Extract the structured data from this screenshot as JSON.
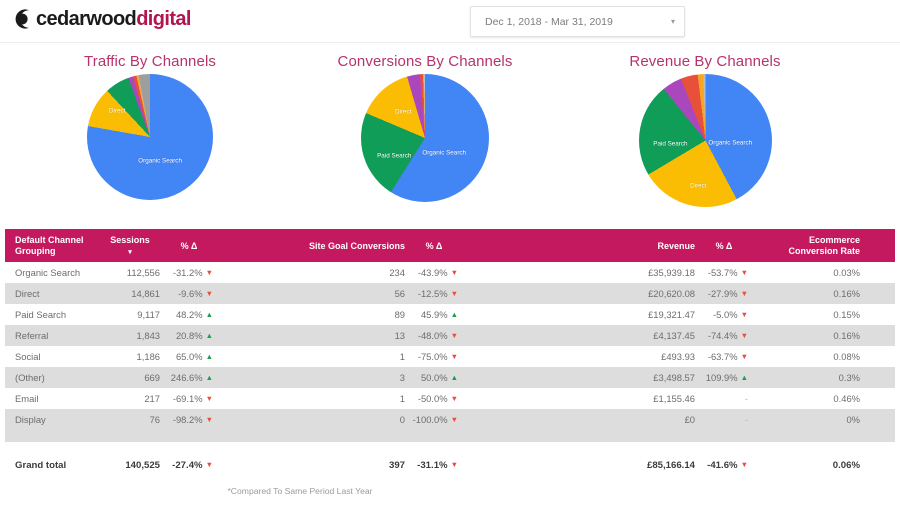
{
  "brand": {
    "logo_icon": "cedarwood-c-mark-icon",
    "name_part1": "cedarwood",
    "name_part2": "digital",
    "accent_pink": "#b2144f"
  },
  "header": {
    "date_range_value": "Dec 1, 2018 - Mar 31, 2019",
    "date_range_placeholder": "Select date range",
    "caret_icon": "chevron-down-icon"
  },
  "charts": [
    {
      "title": "Traffic By Channels",
      "labels": [
        "Organic Search",
        "Direct"
      ]
    },
    {
      "title": "Conversions By Channels",
      "labels": [
        "Organic Search",
        "Paid Search",
        "Direct"
      ]
    },
    {
      "title": "Revenue By Channels",
      "labels": [
        "Organic Search",
        "Paid Search",
        "Direct"
      ]
    }
  ],
  "chart_data": [
    {
      "type": "pie",
      "title": "Traffic By Channels",
      "categories": [
        "Organic Search",
        "Direct",
        "Paid Search",
        "Referral",
        "Social",
        "(Other)",
        "Email",
        "Display"
      ],
      "values": [
        112556,
        14861,
        9117,
        1843,
        1186,
        669,
        217,
        76
      ],
      "unit": "sessions",
      "colors": [
        "#4285f4",
        "#fbbc04",
        "#0f9d58",
        "#ab47bc",
        "#e8503a",
        "#f5a623",
        "#bdbdbd",
        "#9e9e9e"
      ],
      "visible_slice_labels": [
        "Organic Search",
        "Direct"
      ],
      "legend": "none"
    },
    {
      "type": "pie",
      "title": "Conversions By Channels",
      "categories": [
        "Organic Search",
        "Direct",
        "Paid Search",
        "Referral",
        "(Other)",
        "Social",
        "Email",
        "Display"
      ],
      "values": [
        234,
        56,
        89,
        13,
        3,
        1,
        1,
        0
      ],
      "unit": "site goal conversions",
      "colors": [
        "#4285f4",
        "#fbbc04",
        "#0f9d58",
        "#ab47bc",
        "#e8503a",
        "#f5a623",
        "#bdbdbd",
        "#9e9e9e"
      ],
      "visible_slice_labels": [
        "Organic Search",
        "Paid Search",
        "Direct"
      ],
      "legend": "none"
    },
    {
      "type": "pie",
      "title": "Revenue By Channels",
      "categories": [
        "Organic Search",
        "Direct",
        "Paid Search",
        "Referral",
        "(Other)",
        "Email",
        "Social",
        "Display"
      ],
      "values": [
        35939.18,
        20620.08,
        19321.47,
        4137.45,
        3498.57,
        1155.46,
        493.93,
        0
      ],
      "unit": "GBP",
      "colors": [
        "#4285f4",
        "#fbbc04",
        "#0f9d58",
        "#ab47bc",
        "#e8503a",
        "#f5a623",
        "#bdbdbd",
        "#9e9e9e"
      ],
      "visible_slice_labels": [
        "Organic Search",
        "Paid Search",
        "Direct"
      ],
      "legend": "none"
    }
  ],
  "table": {
    "header_color": "#c4195e",
    "columns": [
      {
        "key": "channel",
        "label": "Default Channel Grouping",
        "sorted": false
      },
      {
        "key": "sessions",
        "label": "Sessions",
        "sorted": true,
        "sort_icon": "sort-descending-caret-icon"
      },
      {
        "key": "sesspct",
        "label": "% Δ",
        "sorted": false
      },
      {
        "key": "conv",
        "label": "Site Goal Conversions",
        "sorted": false
      },
      {
        "key": "convpct",
        "label": "% Δ",
        "sorted": false
      },
      {
        "key": "rev",
        "label": "Revenue",
        "sorted": false
      },
      {
        "key": "revpct",
        "label": "% Δ",
        "sorted": false
      },
      {
        "key": "ecr",
        "label": "Ecommerce Conversion Rate",
        "sorted": false
      }
    ],
    "rows": [
      {
        "channel": "Organic Search",
        "sessions": "112,556",
        "sesspct": "-31.2%",
        "sessdir": "down",
        "conv": "234",
        "convpct": "-43.9%",
        "convdir": "down",
        "rev": "£35,939.18",
        "revpct": "-53.7%",
        "revdir": "down",
        "ecr": "0.03%"
      },
      {
        "channel": "Direct",
        "sessions": "14,861",
        "sesspct": "-9.6%",
        "sessdir": "down",
        "conv": "56",
        "convpct": "-12.5%",
        "convdir": "down",
        "rev": "£20,620.08",
        "revpct": "-27.9%",
        "revdir": "down",
        "ecr": "0.16%"
      },
      {
        "channel": "Paid Search",
        "sessions": "9,117",
        "sesspct": "48.2%",
        "sessdir": "up",
        "conv": "89",
        "convpct": "45.9%",
        "convdir": "up",
        "rev": "£19,321.47",
        "revpct": "-5.0%",
        "revdir": "down",
        "ecr": "0.15%"
      },
      {
        "channel": "Referral",
        "sessions": "1,843",
        "sesspct": "20.8%",
        "sessdir": "up",
        "conv": "13",
        "convpct": "-48.0%",
        "convdir": "down",
        "rev": "£4,137.45",
        "revpct": "-74.4%",
        "revdir": "down",
        "ecr": "0.16%"
      },
      {
        "channel": "Social",
        "sessions": "1,186",
        "sesspct": "65.0%",
        "sessdir": "up",
        "conv": "1",
        "convpct": "-75.0%",
        "convdir": "down",
        "rev": "£493.93",
        "revpct": "-63.7%",
        "revdir": "down",
        "ecr": "0.08%"
      },
      {
        "channel": "(Other)",
        "sessions": "669",
        "sesspct": "246.6%",
        "sessdir": "up",
        "conv": "3",
        "convpct": "50.0%",
        "convdir": "up",
        "rev": "£3,498.57",
        "revpct": "109.9%",
        "revdir": "up",
        "ecr": "0.3%"
      },
      {
        "channel": "Email",
        "sessions": "217",
        "sesspct": "-69.1%",
        "sessdir": "down",
        "conv": "1",
        "convpct": "-50.0%",
        "convdir": "down",
        "rev": "£1,155.46",
        "revpct": "-",
        "revdir": "none",
        "ecr": "0.46%"
      },
      {
        "channel": "Display",
        "sessions": "76",
        "sesspct": "-98.2%",
        "sessdir": "down",
        "conv": "0",
        "convpct": "-100.0%",
        "convdir": "down",
        "rev": "£0",
        "revpct": "-",
        "revdir": "none",
        "ecr": "0%"
      }
    ],
    "grand_total": {
      "channel": "Grand total",
      "sessions": "140,525",
      "sesspct": "-27.4%",
      "sessdir": "down",
      "conv": "397",
      "convpct": "-31.1%",
      "convdir": "down",
      "rev": "£85,166.14",
      "revpct": "-41.6%",
      "revdir": "down",
      "ecr": "0.06%"
    }
  },
  "footnote": "*Compared To Same Period Last Year"
}
